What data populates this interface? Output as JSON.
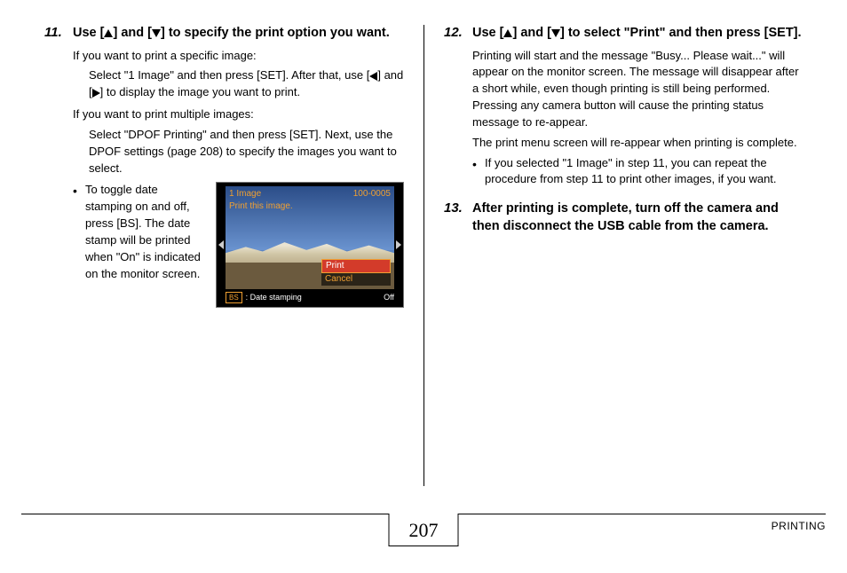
{
  "step11": {
    "number": "11.",
    "title_a": "Use [",
    "title_b": "] and [",
    "title_c": "] to specify the print option you want.",
    "line1": "If you want to print a specific image:",
    "line1_indent_a": "Select \"1 Image\" and then press [SET]. After that, use [",
    "line1_indent_b": "] and [",
    "line1_indent_c": "] to display the image you want to print.",
    "line2": "If you want to print multiple images:",
    "line2_indent": "Select \"DPOF Printing\" and then press [SET]. Next, use the DPOF settings (page 208) to specify the images you want to select.",
    "bullet": "To toggle date stamping on and off, press [BS]. The date stamp will be printed when \"On\" is indicated on the monitor screen."
  },
  "camera": {
    "top_left": "1 Image",
    "top_right": "100-0005",
    "sub": "Print this image.",
    "menu_print": "Print",
    "menu_cancel": "Cancel",
    "bs": "BS",
    "date_label": ": Date stamping",
    "off": "Off"
  },
  "step12": {
    "number": "12.",
    "title_a": "Use [",
    "title_b": "] and [",
    "title_c": "] to select \"Print\" and then press [SET].",
    "para1": "Printing will start and the message \"Busy... Please wait...\" will appear on the monitor screen. The message will disappear after a short while, even though printing is still being performed. Pressing any camera button will cause the printing status message to re-appear.",
    "para2": "The print menu screen will re-appear when printing is complete.",
    "bullet": "If you selected \"1 Image\" in step 11, you can repeat the procedure from step 11 to print other images, if you want."
  },
  "step13": {
    "number": "13.",
    "title": "After printing is complete, turn off the camera and then disconnect the USB cable from the camera."
  },
  "footer": {
    "page": "207",
    "section": "PRINTING"
  }
}
